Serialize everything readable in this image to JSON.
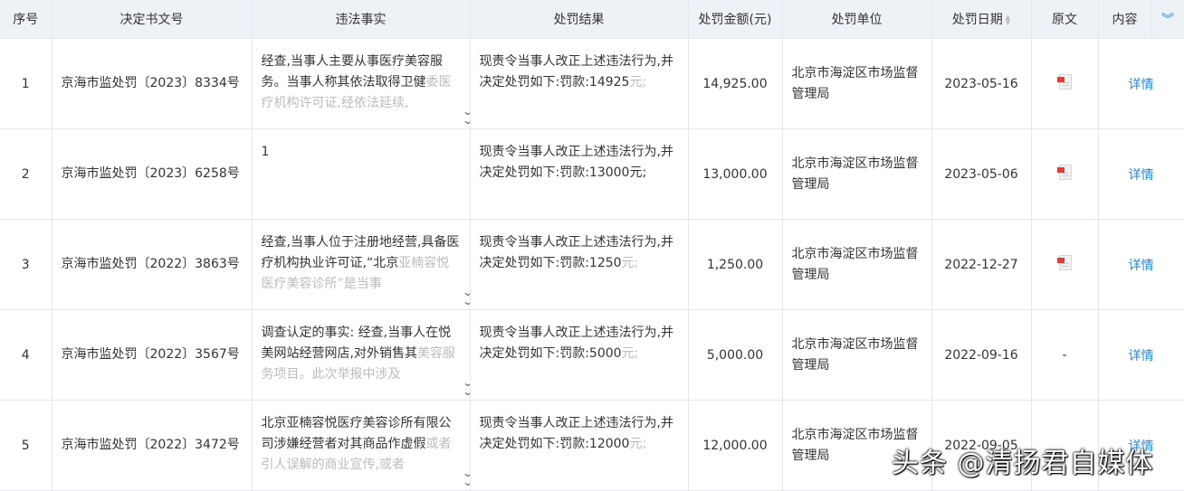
{
  "headers": {
    "seq": "序号",
    "doc_no": "决定书文号",
    "facts": "违法事实",
    "result": "处罚结果",
    "amount": "处罚金额(元)",
    "unit": "处罚单位",
    "date": "处罚日期",
    "original": "原文",
    "content": "内容"
  },
  "rows": [
    {
      "seq": "1",
      "doc_no": "京海市监处罚〔2023〕8334号",
      "fact_visible": "经查,当事人主要从事医疗美容服务。当事人称其依法取得卫健",
      "fact_faded": "委医疗机构许可证,经依法延续,",
      "result_visible": "现责令当事人改正上述违法行为,并决定处罚如下:罚款:14925",
      "result_faded": "元;",
      "amount": "14,925.00",
      "unit": "北京市海淀区市场监督管理局",
      "date": "2023-05-16",
      "original": "pdf-icon",
      "detail": "详情"
    },
    {
      "seq": "2",
      "doc_no": "京海市监处罚〔2023〕6258号",
      "fact_visible": "1",
      "fact_faded": "",
      "result_visible": "现责令当事人改正上述违法行为,并决定处罚如下:罚款:13000元;",
      "result_faded": "",
      "amount": "13,000.00",
      "unit": "北京市海淀区市场监督管理局",
      "date": "2023-05-06",
      "original": "pdf-icon",
      "detail": "详情"
    },
    {
      "seq": "3",
      "doc_no": "京海市监处罚〔2022〕3863号",
      "fact_visible": "经查,当事人位于注册地经营,具备医疗机构执业许可证,“北京",
      "fact_faded": "亚楠容悦医疗美容诊所”是当事",
      "result_visible": "现责令当事人改正上述违法行为,并决定处罚如下:罚款:1250",
      "result_faded": "元;",
      "amount": "1,250.00",
      "unit": "北京市海淀区市场监督管理局",
      "date": "2022-12-27",
      "original": "pdf-icon",
      "detail": "详情"
    },
    {
      "seq": "4",
      "doc_no": "京海市监处罚〔2022〕3567号",
      "fact_visible": "调查认定的事实: 经查,当事人在悦美网站经营网店,对外销售其",
      "fact_faded": "美容服务项目。此次举报中涉及",
      "result_visible": "现责令当事人改正上述违法行为,并决定处罚如下:罚款:5000",
      "result_faded": "元;",
      "amount": "5,000.00",
      "unit": "北京市海淀区市场监督管理局",
      "date": "2022-09-16",
      "original": "-",
      "detail": "详情"
    },
    {
      "seq": "5",
      "doc_no": "京海市监处罚〔2022〕3472号",
      "fact_visible": "北京亚楠容悦医疗美容诊所有限公司涉嫌经营者对其商品作虚假",
      "fact_faded": "或者引人误解的商业宣传,或者",
      "result_visible": "现责令当事人改正上述违法行为,并决定处罚如下:罚款:12000",
      "result_faded": "元;",
      "amount": "12,000.00",
      "unit": "北京市海淀区市场监督管理局",
      "date": "2022-09-05",
      "original": "",
      "detail": "详情"
    }
  ],
  "watermark": "头条 @清扬君自媒体",
  "colors": {
    "header_bg": "#eef1f6",
    "link": "#1e88e5",
    "border": "#e4e7ed"
  }
}
